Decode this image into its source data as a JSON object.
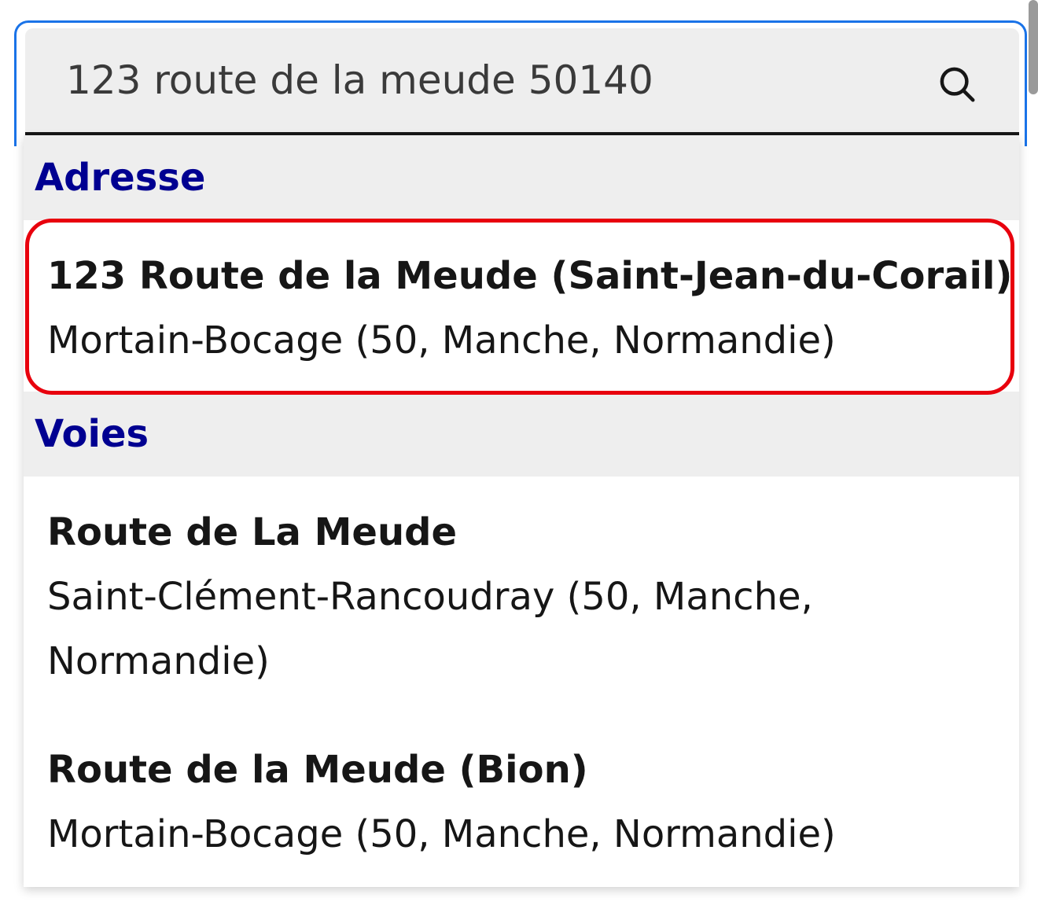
{
  "search": {
    "value": "123 route de la meude 50140",
    "icon": "search-icon"
  },
  "groups": [
    {
      "label": "Adresse",
      "options": [
        {
          "title": "123 Route de la Meude (Saint-Jean-du-Corail)",
          "subtitle": "Mortain-Bocage (50, Manche, Normandie)"
        }
      ]
    },
    {
      "label": "Voies",
      "options": [
        {
          "title": "Route de La Meude",
          "subtitle": "Saint-Clément-Rancoudray (50, Manche, Normandie)"
        },
        {
          "title": "Route de la Meude (Bion)",
          "subtitle": "Mortain-Bocage (50, Manche, Normandie)"
        }
      ]
    }
  ],
  "colors": {
    "focus_border": "#1a73e8",
    "group_label": "#000091",
    "highlight": "#e8000d",
    "field_bg": "#eeeeee"
  }
}
